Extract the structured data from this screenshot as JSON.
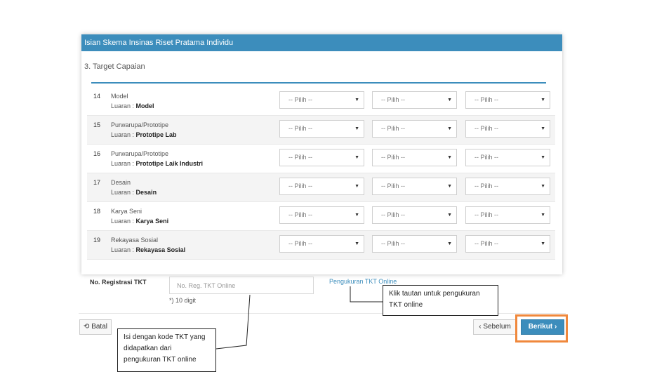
{
  "panel": {
    "title": "Isian Skema Insinas Riset Pratama Individu",
    "section": "3. Target Capaian"
  },
  "rows": [
    {
      "num": "14",
      "name": "Model",
      "luaran_label": "Luaran :",
      "luaran": "Model",
      "selects": [
        "-- Pilih --",
        "-- Pilih --",
        "-- Pilih --"
      ]
    },
    {
      "num": "15",
      "name": "Purwarupa/Prototipe",
      "luaran_label": "Luaran :",
      "luaran": "Prototipe Lab",
      "selects": [
        "-- Pilih --",
        "-- Pilih --",
        "-- Pilih --"
      ]
    },
    {
      "num": "16",
      "name": "Purwarupa/Prototipe",
      "luaran_label": "Luaran :",
      "luaran": "Prototipe Laik Industri",
      "selects": [
        "-- Pilih --",
        "-- Pilih --",
        "-- Pilih --"
      ]
    },
    {
      "num": "17",
      "name": "Desain",
      "luaran_label": "Luaran :",
      "luaran": "Desain",
      "selects": [
        "-- Pilih --",
        "-- Pilih --",
        "-- Pilih --"
      ]
    },
    {
      "num": "18",
      "name": "Karya Seni",
      "luaran_label": "Luaran :",
      "luaran": "Karya Seni",
      "selects": [
        "-- Pilih --",
        "-- Pilih --",
        "-- Pilih --"
      ]
    },
    {
      "num": "19",
      "name": "Rekayasa Sosial",
      "luaran_label": "Luaran :",
      "luaran": "Rekayasa Sosial",
      "selects": [
        "-- Pilih --",
        "-- Pilih --",
        "-- Pilih --"
      ]
    }
  ],
  "registration": {
    "label": "No. Registrasi TKT",
    "placeholder": "No. Reg. TKT Online",
    "hint": "*) 10 digit",
    "link": "Pengukuran TKT Online"
  },
  "buttons": {
    "cancel": "Batal",
    "prev": "Sebelum",
    "next": "Berikut"
  },
  "callouts": {
    "link_note": "Klik tautan untuk pengukuran TKT online",
    "input_note": "Isi dengan kode TKT yang didapatkan dari pengukuran TKT online"
  },
  "colors": {
    "accent": "#3c8dbc",
    "highlight": "#f0883c"
  }
}
